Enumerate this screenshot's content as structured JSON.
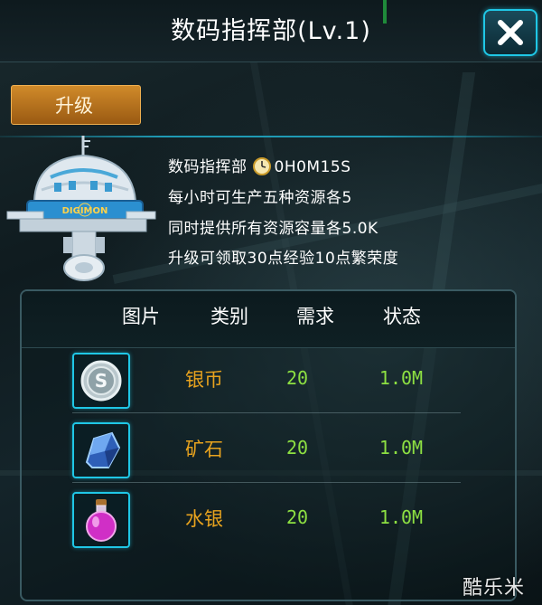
{
  "header": {
    "title": "数码指挥部(Lv.1)",
    "close_icon": "close-x-icon"
  },
  "tabs": {
    "upgrade_label": "升级"
  },
  "building": {
    "name": "数码指挥部",
    "timer_icon": "clock-icon",
    "upgrade_time": "0H0M15S",
    "sign_text": "DIGIMON",
    "info_lines": [
      "每小时可生产五种资源各5",
      "同时提供所有资源容量各5.0K",
      "升级可领取30点经验10点繁荣度"
    ]
  },
  "table": {
    "headers": [
      "图片",
      "类别",
      "需求",
      "状态"
    ],
    "rows": [
      {
        "icon": "silver-coin-icon",
        "name": "银币",
        "required": "20",
        "status": "1.0M"
      },
      {
        "icon": "ore-crystal-icon",
        "name": "矿石",
        "required": "20",
        "status": "1.0M"
      },
      {
        "icon": "mercury-potion-icon",
        "name": "水银",
        "required": "20",
        "status": "1.0M"
      }
    ]
  },
  "watermark": "酷乐米",
  "colors": {
    "accent_cyan": "#1fc7e6",
    "resource_name": "#e8a31e",
    "value_green": "#8de042",
    "tab_orange": "#c07a22"
  }
}
